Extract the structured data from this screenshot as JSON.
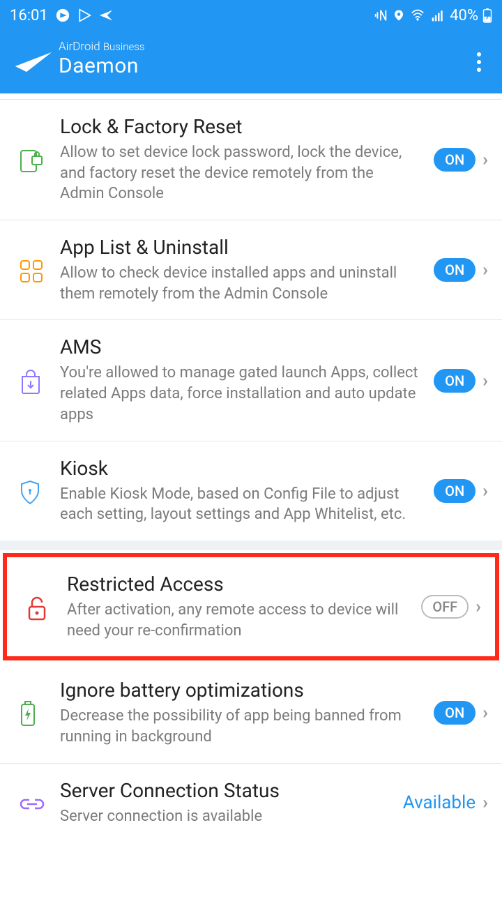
{
  "status_bar": {
    "time": "16:01",
    "battery": "40%"
  },
  "header": {
    "subtitle_brand": "AirDroid",
    "subtitle_biz": "Business",
    "title": "Daemon"
  },
  "items": {
    "lock": {
      "title": "Lock & Factory Reset",
      "desc": "Allow to set device lock password, lock the device, and factory reset the device remotely from the Admin Console",
      "toggle": "ON"
    },
    "applist": {
      "title": "App List & Uninstall",
      "desc": "Allow to check device installed apps and uninstall them remotely from the Admin Console",
      "toggle": "ON"
    },
    "ams": {
      "title": "AMS",
      "desc": "You're allowed to manage gated launch Apps, collect related Apps data, force installation and auto update apps",
      "toggle": "ON"
    },
    "kiosk": {
      "title": "Kiosk",
      "desc": "Enable Kiosk Mode, based on Config File to adjust each setting, layout settings and App Whitelist, etc.",
      "toggle": "ON"
    },
    "restricted": {
      "title": "Restricted Access",
      "desc": "After activation, any remote access to device will need your re-confirmation",
      "toggle": "OFF"
    },
    "battery": {
      "title": "Ignore battery optimizations",
      "desc": "Decrease the possibility of app being banned from running in background",
      "toggle": "ON"
    },
    "server": {
      "title": "Server Connection Status",
      "desc": "Server connection is available",
      "status": "Available"
    }
  }
}
